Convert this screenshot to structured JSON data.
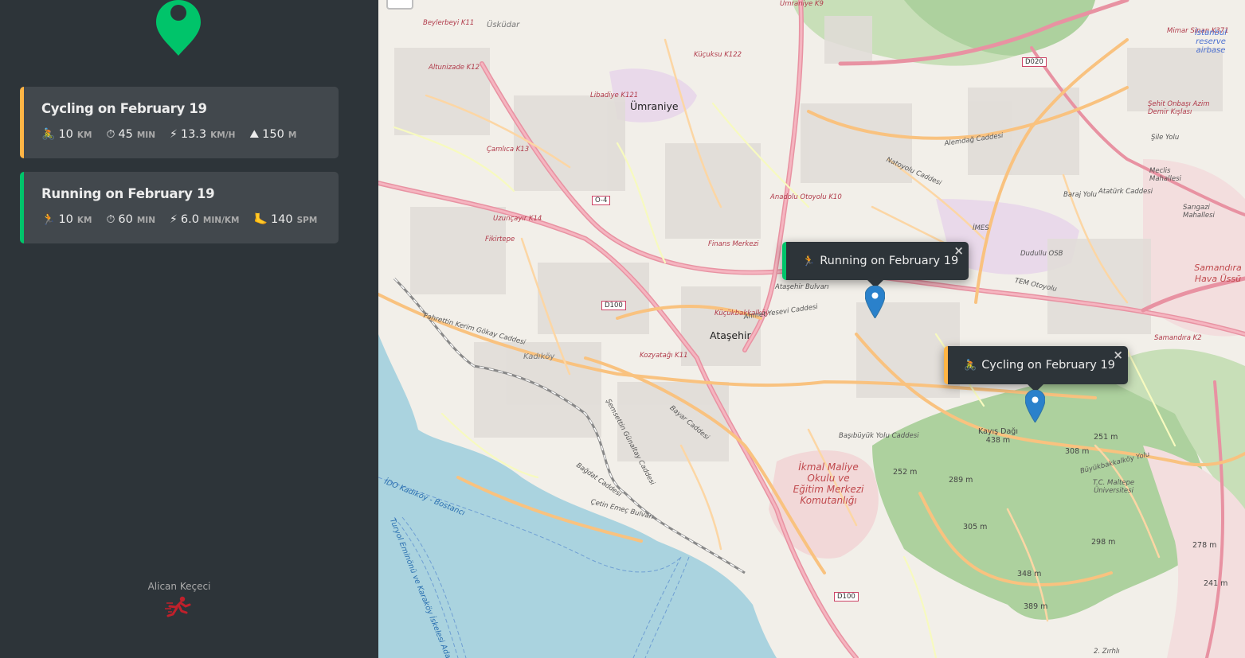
{
  "sidebar": {
    "workouts": [
      {
        "type": "cycling",
        "title": "Cycling on February 19",
        "accent": "#ffb545",
        "details": [
          {
            "icon": "🚴",
            "icon_name": "cyclist-icon",
            "value": "10",
            "unit": "km"
          },
          {
            "icon": "⏱",
            "icon_name": "stopwatch-icon",
            "value": "45",
            "unit": "min"
          },
          {
            "icon": "⚡",
            "icon_name": "lightning-icon",
            "value": "13.3",
            "unit": "km/h"
          },
          {
            "icon": "⛰",
            "icon_name": "mountain-icon",
            "value": "150",
            "unit": "m"
          }
        ]
      },
      {
        "type": "running",
        "title": "Running on February 19",
        "accent": "#00c46a",
        "details": [
          {
            "icon": "🏃",
            "icon_name": "runner-icon",
            "value": "10",
            "unit": "km"
          },
          {
            "icon": "⏱",
            "icon_name": "stopwatch-icon",
            "value": "60",
            "unit": "min"
          },
          {
            "icon": "⚡",
            "icon_name": "lightning-icon",
            "value": "6.0",
            "unit": "min/km"
          },
          {
            "icon": "🦶",
            "icon_name": "foot-icon",
            "value": "140",
            "unit": "spm"
          }
        ]
      }
    ],
    "copyright": "Alican Keçeci"
  },
  "map": {
    "popups": [
      {
        "type": "running",
        "icon": "🏃",
        "label": "Running on February 19",
        "close": "×"
      },
      {
        "type": "cycling",
        "icon": "🚴",
        "label": "Cycling on February 19",
        "close": "×"
      }
    ],
    "labels": {
      "umraniye": "Ümraniye",
      "atasehir": "Ataşehir",
      "kadikoy": "Kadıköy",
      "uskudar": "Üsküdar",
      "beylerbeyi": "Beylerbeyi K11",
      "altunizade": "Altunizade K12",
      "camlica": "Çamlıca K13",
      "uzuncayir": "Uzunçayır K14",
      "fikirtepe": "Fikirtepe",
      "libadiye": "Libadiye K121",
      "kucuksu": "Küçuksu K122",
      "umraniye_k9": "Ümraniye K9",
      "anadolu": "Anadolu Otoyolu K10",
      "finans": "Finans Merkezi",
      "kozyatagi": "Kozyatağı K11",
      "kucukbakkalkoy": "Küçükbakkalköy",
      "imes": "İMES",
      "dudullu": "Dudullu OSB",
      "mimar_sinan": "Mimar Sinan K371",
      "airbase": "İstanbul reserve airbase",
      "sehit": "Şehit Onbaşı Azim Demir Kışlası",
      "meclis": "Meclis Mahallesi",
      "sarigazi": "Sarıgazi Mahallesi",
      "samandira": "Samandıra Hava Üssü",
      "samandira_k2": "Samandıra K2",
      "ikmal": "İkmal Maliye Okulu ve Eğitim Merkezi Komutanlığı",
      "kayisdagi": "Kayış Dağı 438 m",
      "tc_maltepe": "T.C. Maltepe Üniversitesi",
      "ido": "İDO Kadıköy - Bostancı",
      "turyol": "Turyol Eminönü ve Karaköy İskelesi Adalar",
      "zirhli": "2. Zırhlı",
      "bagdat": "Bağdat Caddesi",
      "d100": "D100",
      "o4": "O-4",
      "d020": "D020",
      "tem": "TEM Otoyolu",
      "sile": "Şile Yolu",
      "alemdag": "Alemdağ Caddesi",
      "natoyolu": "Natoyolu Caddesi",
      "baraj": "Baraj Yolu",
      "ataturk": "Atatürk Caddesi",
      "basibuyuk": "Başıbüyük Yolu Caddesi",
      "buyukbakkalkoy": "Büyükbakkalköy Yolu",
      "semsettin": "Şemsettin Günaltay Caddesi",
      "cetin": "Çetin Emeç Bulvarı",
      "kerim": "Fahrettin Kerim Gökay Caddesi",
      "bayar": "Bayar Caddesi",
      "atasehir_bulvari": "Ataşehir Bulvarı",
      "ahmet_yesevi": "Ahmet Yesevi Caddesi",
      "peak_252": "252 m",
      "peak_289": "289 m",
      "peak_305": "305 m",
      "peak_348": "348 m",
      "peak_389": "389 m",
      "peak_298": "298 m",
      "peak_278": "278 m",
      "peak_241": "241 m",
      "peak_308": "308 m",
      "peak_251": "251 m"
    }
  }
}
